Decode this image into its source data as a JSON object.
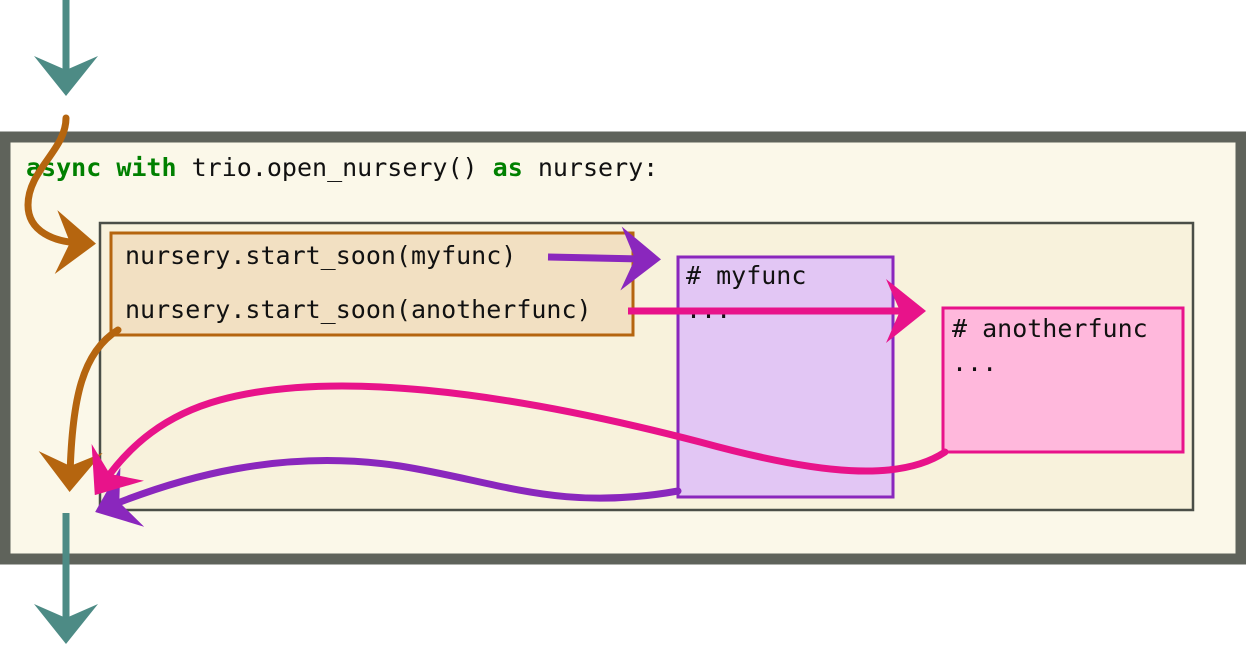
{
  "header_line": {
    "kw_async": "async",
    "kw_with": "with",
    "call": "trio.open_nursery()",
    "kw_as": "as",
    "target": "nursery:"
  },
  "start_calls": {
    "line1": "nursery.start_soon(myfunc)",
    "line2": "nursery.start_soon(anotherfunc)"
  },
  "myfunc_box": {
    "comment": "# myfunc",
    "ellipsis": "..."
  },
  "anotherfunc_box": {
    "comment": "# anotherfunc",
    "ellipsis": "..."
  },
  "colors": {
    "outer_frame": "#5f635b",
    "outer_fill": "#fbf8e9",
    "inner_fill": "#f8f2dc",
    "inner_border": "#4a4e47",
    "main_flow": "#4d8b85",
    "calls_border": "#b5650f",
    "calls_fill": "#f2e0c2",
    "myfunc": "#8a27bd",
    "myfunc_fill": "#e2c6f4",
    "anotherfunc": "#e8138a",
    "anotherfunc_fill": "#ffb8dc",
    "keyword": "#008000"
  }
}
